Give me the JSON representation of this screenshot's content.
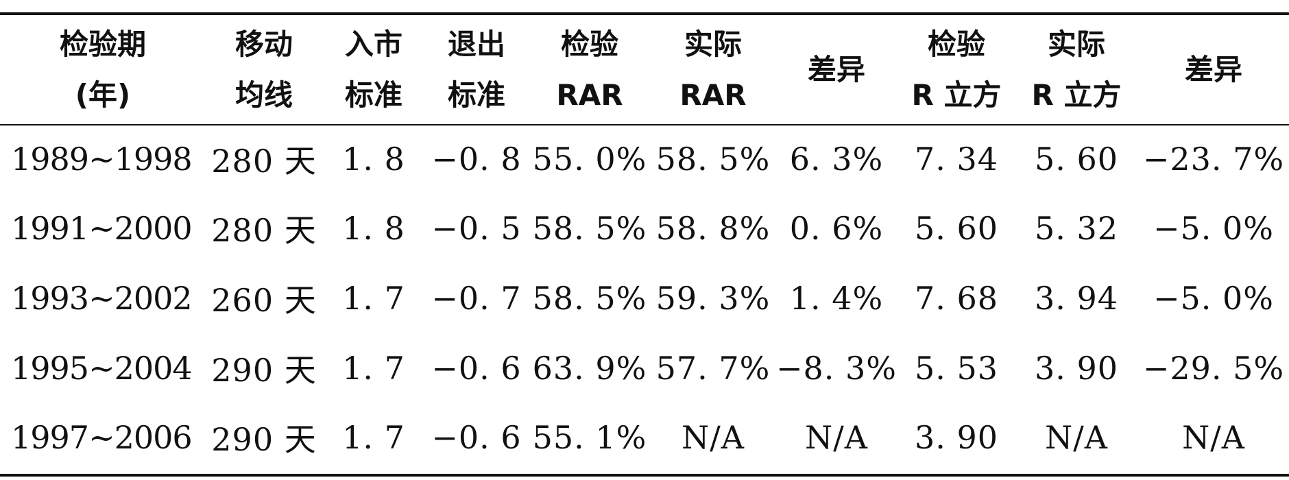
{
  "table": {
    "headers": [
      [
        "检验期",
        "(年)"
      ],
      [
        "移动",
        "均线"
      ],
      [
        "入市",
        "标准"
      ],
      [
        "退出",
        "标准"
      ],
      [
        "检验",
        "RAR"
      ],
      [
        "实际",
        "RAR"
      ],
      [
        "差异"
      ],
      [
        "检验",
        "R 立方"
      ],
      [
        "实际",
        "R 立方"
      ],
      [
        "差异"
      ]
    ],
    "rows": [
      [
        "1989~1998",
        "280 天",
        "1. 8",
        "−0. 8",
        "55. 0%",
        "58. 5%",
        "6. 3%",
        "7. 34",
        "5. 60",
        "−23. 7%"
      ],
      [
        "1991~2000",
        "280 天",
        "1. 8",
        "−0. 5",
        "58. 5%",
        "58. 8%",
        "0. 6%",
        "5. 60",
        "5. 32",
        "−5. 0%"
      ],
      [
        "1993~2002",
        "260 天",
        "1. 7",
        "−0. 7",
        "58. 5%",
        "59. 3%",
        "1. 4%",
        "7. 68",
        "3. 94",
        "−5. 0%"
      ],
      [
        "1995~2004",
        "290 天",
        "1. 7",
        "−0. 6",
        "63. 9%",
        "57. 7%",
        "−8. 3%",
        "5. 53",
        "3. 90",
        "−29. 5%"
      ],
      [
        "1997~2006",
        "290 天",
        "1. 7",
        "−0. 6",
        "55. 1%",
        "N/A",
        "N/A",
        "3. 90",
        "N/A",
        "N/A"
      ]
    ]
  }
}
